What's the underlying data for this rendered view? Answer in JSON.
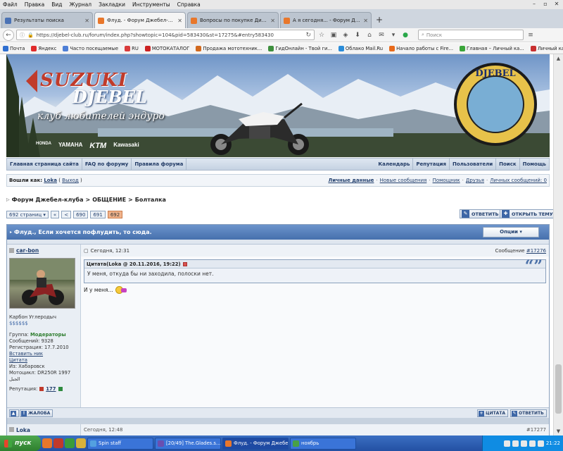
{
  "menubar": {
    "items": [
      "Файл",
      "Правка",
      "Вид",
      "Журнал",
      "Закладки",
      "Инструменты",
      "Справка"
    ],
    "controls": [
      "–",
      "▫",
      "✕"
    ]
  },
  "tabs": [
    {
      "label": "Результаты поиска",
      "active": false
    },
    {
      "label": "Флуд. - Форум Джебел-клуба",
      "active": true
    },
    {
      "label": "Вопросы по покупке Дитри -...",
      "active": false
    },
    {
      "label": "А я сегодня... - Форум Джеб...",
      "active": false
    }
  ],
  "navbar": {
    "url": "https://djebel-club.ru/forum/index.php?showtopic=104&pid=583430&st=17275&#entry583430",
    "search_placeholder": "Поиск"
  },
  "bookmarks": [
    {
      "label": "Почта",
      "color": "#2f6fd0"
    },
    {
      "label": "Яндекс",
      "color": "#e02b2b"
    },
    {
      "label": "Часто посещаемые",
      "color": "#4e7fd6"
    },
    {
      "label": "RU",
      "color": "#d93b3b"
    },
    {
      "label": "МОТОКАТАЛОГ",
      "color": "#cc2222"
    },
    {
      "label": "Продажа мототехник...",
      "color": "#d2691e"
    },
    {
      "label": "ГидОнлайн - Твой ги...",
      "color": "#3d8f3d"
    },
    {
      "label": "Облако Mail.Ru",
      "color": "#2a8cd8"
    },
    {
      "label": "Начало работы с Fire...",
      "color": "#e86a1b"
    },
    {
      "label": "Главная – Личный ка...",
      "color": "#3aa53a"
    },
    {
      "label": "Личный кабинет - Ул...",
      "color": "#c82f2f"
    }
  ],
  "banner": {
    "brand_top": "SUZUKI",
    "brand_main": "DJEBEL",
    "slogan": "клуб любителей эндуро",
    "brands": [
      "HONDA",
      "YAMAHA",
      "KTM",
      "Kawasaki"
    ],
    "emblem_text": "DJEBEL"
  },
  "nav": {
    "left": [
      "Главная страница сайта",
      "FAQ по форуму",
      "Правила форума"
    ],
    "right": [
      "Календарь",
      "Репутация",
      "Пользователи",
      "Поиск",
      "Помощь"
    ]
  },
  "userbar": {
    "prefix": "Вошли как:",
    "username": "Loka",
    "logout": "Выход",
    "links": [
      "Личные данные",
      "Новые сообщения",
      "Помощник",
      "Друзья",
      "Личных сообщений: 0"
    ]
  },
  "breadcrumb": [
    "Форум Джебел-клуба",
    "ОБЩЕНИЕ",
    "Болталка"
  ],
  "pager": {
    "total": "692 страниц",
    "first": "«",
    "prev": "<",
    "pages": [
      "690",
      "691"
    ],
    "current": "692"
  },
  "buttons": {
    "reply": "ОТВЕТИТЬ",
    "new_topic": "ОТКРЫТЬ ТЕМУ",
    "options": "Опции ▾",
    "complaint": "ЖАЛОБА",
    "quote": "ЦИТАТА",
    "reply_small": "ОТВЕТИТЬ"
  },
  "thread": {
    "title": "Флуд., Если хочется пофлудить, то сюда."
  },
  "post": {
    "author": "car-bon",
    "date": "Сегодня, 12:31",
    "number_label": "Сообщение",
    "number": "#17276",
    "rank": "Карбон Углеродыч",
    "pips": "$$$$$$",
    "group_label": "Группа:",
    "group": "Модераторы",
    "messages": "Сообщений: 9328",
    "registered": "Регистрация: 17.7.2010",
    "insert_nick": "Вставить ник",
    "quote_link": "Цитата",
    "from": "Из: Хабаровск",
    "moto": "Мотоцикл: DR250R 1997",
    "extra": "الجبل",
    "rep_label": "Репутация:",
    "rep_value": "177",
    "quote_header": "Цитата(Loka @ 20.11.2016, 19:22)",
    "quote_text": "У меня, откуда бы ни заходила, полоски нет.",
    "text": "И у меня..."
  },
  "next_post": {
    "author": "Loka",
    "date": "Сегодня, 12:48",
    "number": "#17277"
  },
  "taskbar": {
    "start": "пуск",
    "tasks": [
      {
        "label": "Spin staff",
        "color": "#53a0e0",
        "active": false
      },
      {
        "label": "[20/49] The.Glades.s...",
        "color": "#6a4fb0",
        "active": false
      },
      {
        "label": "Флуд. - Форум Джебел...",
        "color": "#e8772b",
        "active": true
      },
      {
        "label": "ноябрь",
        "color": "#48a048",
        "active": false
      }
    ],
    "clock": "21:22"
  },
  "colors": {
    "accent": "#4670ad",
    "link": "#23406e",
    "moderators": "#2e7d2e",
    "current_page": "#f0b38c"
  }
}
